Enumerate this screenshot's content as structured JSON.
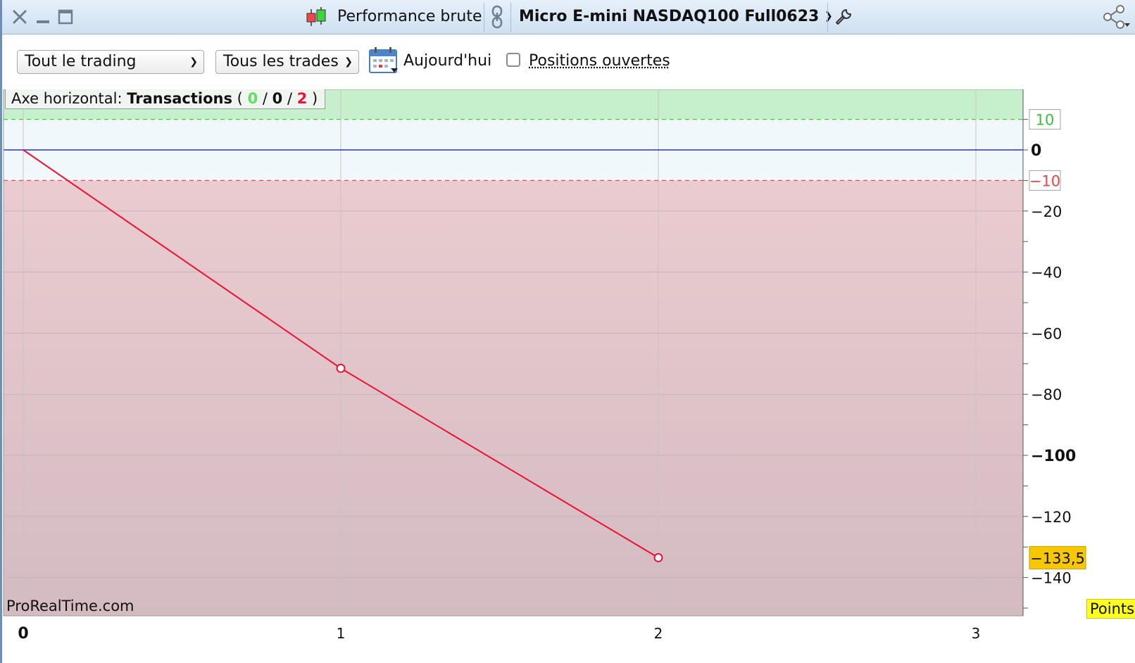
{
  "window": {
    "title": "Performance brute",
    "instrument": "Micro E-mini NASDAQ100 Full0623"
  },
  "toolbar": {
    "scope_select": "Tout le trading",
    "trades_select": "Tous les trades",
    "period_label": "Aujourd'hui",
    "open_positions_label": "Positions ouvertes",
    "open_positions_checked": false
  },
  "chart_info": {
    "prefix": "Axe horizontal:",
    "label": "Transactions",
    "open_paren": "(",
    "wins": "0",
    "neutral": "0",
    "losses": "2",
    "sep": "/",
    "close_paren": ")"
  },
  "watermark": "ProRealTime.com",
  "units_badge": "Points",
  "colors": {
    "positive_zone": "#c6efcc",
    "neutral_zone": "#f1f8fb",
    "negative_zone_top": "#eaccd0",
    "negative_zone_bottom": "#d3bbc2",
    "line": "#ee1133",
    "zero_line": "#2233bb",
    "last_value_bg": "#f7c800"
  },
  "chart_data": {
    "type": "line",
    "x": [
      0,
      1,
      2
    ],
    "y": [
      0,
      -71.5,
      -133.5
    ],
    "xlim": [
      0,
      3
    ],
    "ylim": [
      -155,
      20
    ],
    "x_ticks": [
      "0",
      "1",
      "2",
      "3"
    ],
    "y_ticks": [
      {
        "value": 10,
        "label": "10",
        "style": "pos"
      },
      {
        "value": 0,
        "label": "0",
        "style": "zero"
      },
      {
        "value": -10,
        "label": "-10",
        "style": "neg"
      },
      {
        "value": -20,
        "label": "-20",
        "style": "normal"
      },
      {
        "value": -40,
        "label": "-40",
        "style": "normal"
      },
      {
        "value": -60,
        "label": "-60",
        "style": "normal"
      },
      {
        "value": -80,
        "label": "-80",
        "style": "normal"
      },
      {
        "value": -100,
        "label": "-100",
        "style": "bold"
      },
      {
        "value": -120,
        "label": "-120",
        "style": "normal"
      },
      {
        "value": -140,
        "label": "-140",
        "style": "normal"
      }
    ],
    "positive_threshold": 10,
    "negative_threshold": -10,
    "last_value": {
      "value": -133.5,
      "label": "-133,5"
    },
    "grid": true
  }
}
